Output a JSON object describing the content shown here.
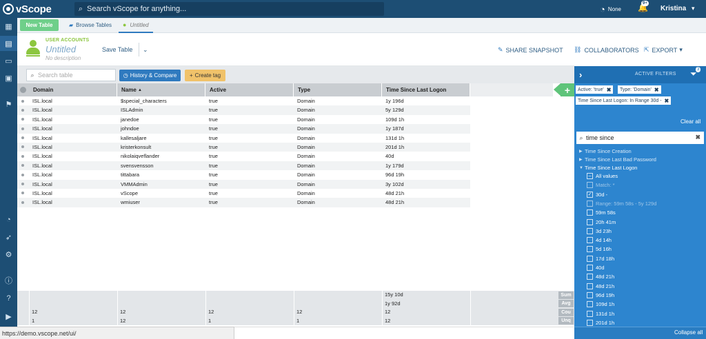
{
  "topbar": {
    "brand": "vScope",
    "search_placeholder": "Search vScope for anything...",
    "connection_label": "None",
    "notifications_badge": "9+",
    "user_name": "Kristina"
  },
  "tabbar": {
    "new_table": "New Table",
    "browse_tables": "Browse Tables",
    "active_tab": "Untitled"
  },
  "header": {
    "category": "USER ACCOUNTS",
    "title": "Untitled",
    "description": "No description",
    "save_table": "Save Table",
    "share_snapshot": "SHARE SNAPSHOT",
    "collaborators": "COLLABORATORS",
    "export": "EXPORT"
  },
  "toolbar": {
    "search_placeholder": "Search table",
    "history_compare": "History & Compare",
    "create_tag": "Create tag"
  },
  "table": {
    "columns": [
      "Domain",
      "Name",
      "Active",
      "Type",
      "Time Since Last Logon"
    ],
    "sort_indicator": "▲",
    "rows": [
      [
        "ISL.local",
        "$special_characters",
        "true",
        "Domain",
        "1y 196d"
      ],
      [
        "ISL.local",
        "ISLAdmin",
        "true",
        "Domain",
        "5y 129d"
      ],
      [
        "ISL.local",
        "janedoe",
        "true",
        "Domain",
        "109d 1h"
      ],
      [
        "ISL.local",
        "johndoe",
        "true",
        "Domain",
        "1y 187d"
      ],
      [
        "ISL.local",
        "kallesaljare",
        "true",
        "Domain",
        "131d 1h"
      ],
      [
        "ISL.local",
        "kristerkonsult",
        "true",
        "Domain",
        "201d 1h"
      ],
      [
        "ISL.local",
        "nikolaiqveflander",
        "true",
        "Domain",
        "40d"
      ],
      [
        "ISL.local",
        "svensvensson",
        "true",
        "Domain",
        "1y 179d"
      ],
      [
        "ISL.local",
        "tittabara",
        "true",
        "Domain",
        "96d 19h"
      ],
      [
        "ISL.local",
        "VMMAdmin",
        "true",
        "Domain",
        "3y 102d"
      ],
      [
        "ISL.local",
        "vScope",
        "true",
        "Domain",
        "48d 21h"
      ],
      [
        "ISL.local",
        "wmiuser",
        "true",
        "Domain",
        "48d 21h"
      ]
    ]
  },
  "summary": {
    "sum": {
      "label": "Sum",
      "values": [
        "",
        "",
        "",
        "",
        "15y 10d"
      ]
    },
    "avg": {
      "label": "Avg",
      "values": [
        "",
        "",
        "",
        "",
        "1y 92d"
      ]
    },
    "count": {
      "label": "Cou",
      "values": [
        "12",
        "12",
        "12",
        "12",
        "12"
      ]
    },
    "unique": {
      "label": "Unq",
      "values": [
        "1",
        "12",
        "1",
        "1",
        "12"
      ]
    }
  },
  "status_bar": {
    "url": "https://demo.vscope.net/ui/"
  },
  "filters": {
    "title": "ACTIVE FILTERS",
    "count_badge": "3",
    "chips": [
      "Active: 'true'",
      "Type: 'Domain'",
      "Time Since Last Logon: In Range 30d -"
    ],
    "clear_all": "Clear all",
    "search_value": "time since",
    "tree": [
      "Time Since Creation",
      "Time Since Last Bad Password",
      "Time Since Last Logon"
    ],
    "options": [
      {
        "label": "All values",
        "state": "partial",
        "dim": false
      },
      {
        "label": "Match: *",
        "state": "none",
        "dim": true
      },
      {
        "label": "30d -",
        "state": "checked",
        "dim": false
      },
      {
        "label": "Range: 59m 58s - 5y 129d",
        "state": "none",
        "dim": true
      },
      {
        "label": "59m 58s",
        "state": "none",
        "dim": false
      },
      {
        "label": "20h 41m",
        "state": "none",
        "dim": false
      },
      {
        "label": "3d 23h",
        "state": "none",
        "dim": false
      },
      {
        "label": "4d 14h",
        "state": "none",
        "dim": false
      },
      {
        "label": "5d 16h",
        "state": "none",
        "dim": false
      },
      {
        "label": "17d 18h",
        "state": "none",
        "dim": false
      },
      {
        "label": "40d",
        "state": "none",
        "dim": false
      },
      {
        "label": "48d 21h",
        "state": "none",
        "dim": false
      },
      {
        "label": "48d 21h",
        "state": "none",
        "dim": false
      },
      {
        "label": "96d 19h",
        "state": "none",
        "dim": false
      },
      {
        "label": "109d 1h",
        "state": "none",
        "dim": false
      },
      {
        "label": "131d 1h",
        "state": "none",
        "dim": false
      },
      {
        "label": "201d 1h",
        "state": "none",
        "dim": false
      }
    ],
    "collapse_all": "Collapse all"
  },
  "colors": {
    "topbar": "#1d4e74",
    "accent": "#2f7abf",
    "green": "#8cc63f",
    "panel": "#2d85cf"
  }
}
